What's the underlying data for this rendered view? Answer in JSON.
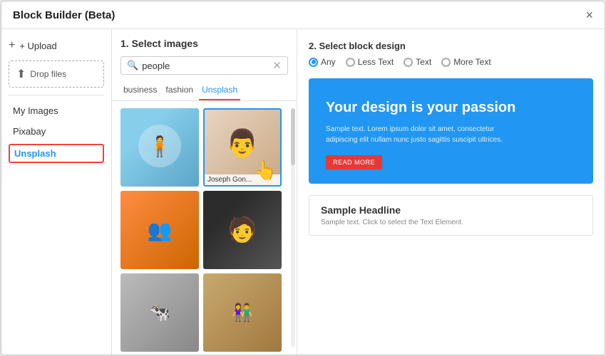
{
  "modal": {
    "title": "Block Builder (Beta)"
  },
  "close_button": "×",
  "sidebar": {
    "upload_label": "+ Upload",
    "drop_files_label": "Drop files",
    "my_images_label": "My Images",
    "pixabay_label": "Pixabay",
    "unsplash_label": "Unsplash"
  },
  "center": {
    "title": "1. Select images",
    "search_value": "people",
    "tabs": [
      {
        "id": "business",
        "label": "business"
      },
      {
        "id": "fashion",
        "label": "fashion"
      },
      {
        "id": "unsplash",
        "label": "Unsplash",
        "active": true
      }
    ],
    "images": [
      {
        "id": "img1",
        "label": "",
        "type": "person1"
      },
      {
        "id": "img2",
        "label": "Joseph Gon...",
        "type": "person2",
        "selected": true
      },
      {
        "id": "img3",
        "label": "",
        "type": "group"
      },
      {
        "id": "img4",
        "label": "",
        "type": "woman"
      },
      {
        "id": "img5",
        "label": "",
        "type": "bw"
      },
      {
        "id": "img6",
        "label": "",
        "type": "crowd"
      }
    ]
  },
  "right": {
    "block_design_title": "2. Select block design",
    "radio_options": [
      {
        "id": "any",
        "label": "Any",
        "checked": true
      },
      {
        "id": "less_text",
        "label": "Less Text",
        "checked": false
      },
      {
        "id": "text",
        "label": "Text",
        "checked": false
      },
      {
        "id": "more_text",
        "label": "More Text",
        "checked": false
      }
    ],
    "preview": {
      "headline": "Your design is your passion",
      "body": "Sample text. Lorem ipsum dolor sit amet, consectetur adipiscing elit nullam nunc justo sagittis suscipit ultrices.",
      "read_more": "READ MORE"
    },
    "sample": {
      "title": "Sample Headline",
      "subtitle": "Sample text. Click to select the Text Element."
    }
  }
}
